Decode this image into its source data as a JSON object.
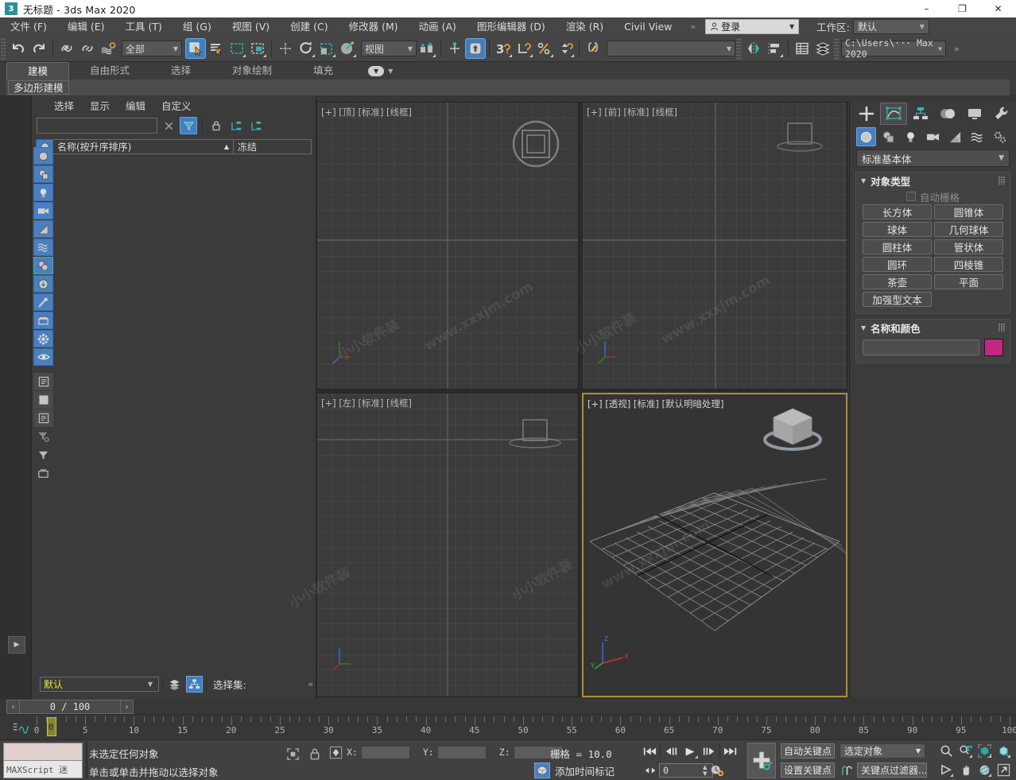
{
  "window": {
    "title": "无标题 - 3ds Max 2020",
    "app_icon": "3dsmax-icon",
    "minimize": "–",
    "maximize": "❐",
    "close": "✕"
  },
  "menubar": {
    "items": [
      "文件 (F)",
      "编辑 (E)",
      "工具 (T)",
      "组 (G)",
      "视图 (V)",
      "创建 (C)",
      "修改器 (M)",
      "动画 (A)",
      "图形编辑器 (D)",
      "渲染 (R)",
      "Civil View"
    ],
    "overflow": "»",
    "login_label": "登录",
    "login_caret": "▼",
    "workspace_label": "工作区:",
    "workspace_value": "默认",
    "workspace_caret": "▼"
  },
  "toolbar": {
    "undo": "undo-icon",
    "redo": "redo-icon",
    "select_and_link": "select-and-link-icon",
    "unlink": "unlink-icon",
    "bind_to_space_warp": "bind-space-warp-icon",
    "selection_filter_value": "全部",
    "selection_filter_caret": "▼",
    "select_object": "select-object-icon",
    "select_by_name": "select-by-name-icon",
    "rect_select_region": "rectangular-select-region-icon",
    "window_crossing": "window-crossing-icon",
    "select_and_move": "select-and-move-icon",
    "select_and_rotate": "select-and-rotate-icon",
    "select_and_scale": "select-and-scale-icon",
    "select_and_place": "select-and-place-icon",
    "ref_coord_value": "视图",
    "ref_coord_caret": "▼",
    "use_pivot_center": "use-pivot-point-center-icon",
    "snap_toggle": "snaps-toggle-icon",
    "named_selection_sets": "named-selection-sets-icon",
    "snap3d": "3d-snap-icon",
    "angle_snap": "angle-snap-icon",
    "percent_snap": "percent-snap-icon",
    "spinner_snap": "spinner-snap-icon",
    "edit_named_sets": "edit-named-selection-sets-icon",
    "named_set_value": "",
    "named_set_caret": "▼",
    "mirror": "mirror-icon",
    "align": "align-icon",
    "layer_explorer": "layer-explorer-icon",
    "scene_explorer": "scene-explorer-icon",
    "project_folder": "C:\\Users\\··· Max 2020",
    "project_caret": "▼",
    "overflow": "»"
  },
  "ribbon": {
    "tabs": [
      "建模",
      "自由形式",
      "选择",
      "对象绘制",
      "填充"
    ],
    "selected_tab": "建模",
    "dropdown_icon": "ribbon-dropdown-icon",
    "dropdown_caret": "▼",
    "panel_label": "多边形建模"
  },
  "explorer": {
    "menus": [
      "选择",
      "显示",
      "编辑",
      "自定义"
    ],
    "search_value": "",
    "clear_icon": "clear-icon",
    "filter_icon": "filter-toggle-icon",
    "lock_icon": "lock-icon",
    "expand_all_icon": "expand-all-icon",
    "collapse_all_icon": "collapse-all-icon",
    "col_object_icon": "object-type-column-icon",
    "col_name": "名称(按升序排序)",
    "col_sort_arrow": "▲",
    "col_frozen": "冻结",
    "vtools": [
      "geometry-filter-icon",
      "shapes-filter-icon",
      "lights-filter-icon",
      "cameras-filter-icon",
      "helpers-filter-icon",
      "space-warps-filter-icon",
      "groups-filter-icon",
      "xrefs-filter-icon",
      "bones-filter-icon",
      "containers-filter-icon",
      "particles-filter-icon",
      "visibility-icon",
      "layers-list-icon",
      "objects-list-icon",
      "properties-list-icon",
      "filter-settings-icon",
      "filter-icon",
      "toolbar-icon"
    ]
  },
  "selection_set_bar": {
    "value": "默认",
    "caret": "▼",
    "layers_icon": "layers-icon",
    "hierarchy_icon": "hierarchy-icon",
    "label": "选择集:",
    "more": "»"
  },
  "frame_nav": {
    "prev": "‹",
    "value": "0 / 100",
    "next": "›"
  },
  "left_strip": {
    "expand_arrow": "expand-panel-icon",
    "quad_layout": "viewport-layout-icon"
  },
  "viewports": [
    {
      "name": "top",
      "label": "[+] [顶] [标准] [线框]",
      "active": false
    },
    {
      "name": "front",
      "label": "[+] [前] [标准] [线框]",
      "active": false
    },
    {
      "name": "left",
      "label": "[+] [左] [标准] [线框]",
      "active": false
    },
    {
      "name": "persp",
      "label": "[+] [透视] [标准] [默认明暗处理]",
      "active": true
    }
  ],
  "axis_labels": {
    "x": "X",
    "y": "Y",
    "z": "Z"
  },
  "command_panel": {
    "tabs": [
      "create-tab-icon",
      "modify-tab-icon",
      "hierarchy-tab-icon",
      "motion-tab-icon",
      "display-tab-icon",
      "utilities-tab-icon"
    ],
    "selected_tab_index": 0,
    "subtabs": [
      "geometry-icon",
      "shapes-icon",
      "lights-icon",
      "cameras-icon",
      "helpers-icon",
      "space-warps-icon",
      "systems-icon"
    ],
    "selected_subtab_index": 0,
    "category_value": "标准基本体",
    "category_caret": "▼",
    "object_type": {
      "title": "对象类型",
      "caret": "▼",
      "autogrid_label": "自动栅格",
      "buttons": [
        "长方体",
        "圆锥体",
        "球体",
        "几何球体",
        "圆柱体",
        "管状体",
        "圆环",
        "四棱锥",
        "茶壶",
        "平面",
        "加强型文本"
      ]
    },
    "name_and_color": {
      "title": "名称和颜色",
      "caret": "▼",
      "name_value": "",
      "color": "#c4277f"
    }
  },
  "timeline": {
    "icon": "track-bar-icon",
    "ticks": [
      0,
      5,
      10,
      15,
      20,
      25,
      30,
      35,
      40,
      45,
      50,
      55,
      60,
      65,
      70,
      75,
      80,
      85,
      90,
      95,
      100
    ],
    "current_frame_label": "0",
    "range_start": 0,
    "range_end": 100
  },
  "statusbar": {
    "maxscript_label": "MAXScript 迷",
    "line1": "未选定任何对象",
    "line2": "单击或单击并拖动以选择对象",
    "selection_lock_icon": "selection-lock-icon",
    "lock_icon": "lock-icon",
    "coord_icon": "absolute-relative-icon",
    "x_label": "X:",
    "x_value": "",
    "y_label": "Y:",
    "y_value": "",
    "z_label": "Z:",
    "z_value": "",
    "grid_label": "栅格 = 10.0",
    "add_time_tag_icon": "add-time-tag-icon",
    "add_time_tag": "添加时间标记",
    "playback": {
      "go_to_start": "go-to-start-icon",
      "prev_frame": "previous-frame-icon",
      "play": "play-animation-icon",
      "next_frame": "next-frame-icon",
      "go_to_end": "go-to-end-icon",
      "current_frame": "0",
      "key_mode_icon": "key-mode-toggle-icon",
      "time_config_icon": "time-configuration-icon"
    },
    "animation": {
      "add_key_icon": "set-key-icon",
      "auto_key": "自动关键点",
      "set_key": "设置关键点",
      "filter_target": "选定对象",
      "filter_caret": "▼",
      "key_filter_icon": "key-filters-icon",
      "key_filters": "关键点过滤器..."
    },
    "nav_row1": [
      "zoom-icon",
      "zoom-all-icon",
      "zoom-extents-icon",
      "zoom-region-icon"
    ],
    "nav_row2": [
      "field-of-view-icon",
      "pan-view-icon",
      "orbit-icon",
      "maximize-viewport-icon"
    ]
  },
  "watermarks": [
    "www.xxxjm.com",
    "小小软件装"
  ]
}
